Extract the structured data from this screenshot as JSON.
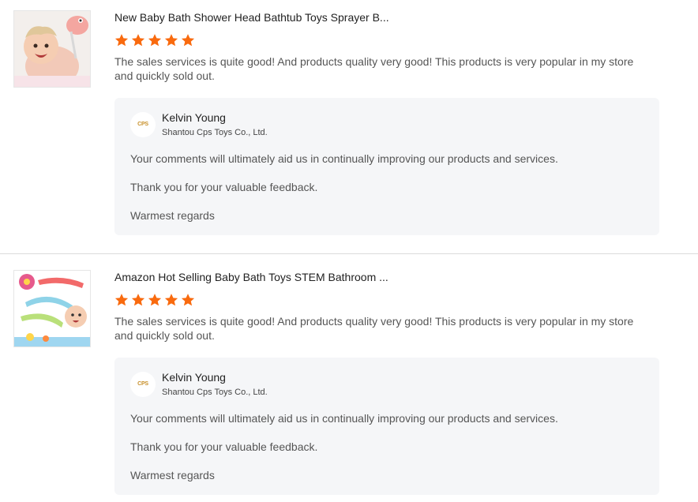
{
  "reviews": [
    {
      "title": "New Baby Bath Shower Head Bathtub Toys Sprayer B...",
      "rating": 5,
      "text": "The sales services is quite good! And products quality very good! This products is very popular in my store and quickly sold out.",
      "reply": {
        "logo_text": "CPS",
        "name": "Kelvin Young",
        "company": "Shantou Cps Toys Co., Ltd.",
        "lines": [
          "Your comments will ultimately aid us in continually improving our products and services.",
          "Thank you for your valuable feedback.",
          "Warmest regards"
        ]
      }
    },
    {
      "title": "Amazon Hot Selling Baby Bath Toys STEM Bathroom ...",
      "rating": 5,
      "text": "The sales services is quite good! And products quality very good! This products is very popular in my store and quickly sold out.",
      "reply": {
        "logo_text": "CPS",
        "name": "Kelvin Young",
        "company": "Shantou Cps Toys Co., Ltd.",
        "lines": [
          "Your comments will ultimately aid us in continually improving our products and services.",
          "Thank you for your valuable feedback.",
          "Warmest regards"
        ]
      }
    }
  ],
  "colors": {
    "star": "#f96a0e",
    "reply_bg": "#f5f6f8"
  }
}
